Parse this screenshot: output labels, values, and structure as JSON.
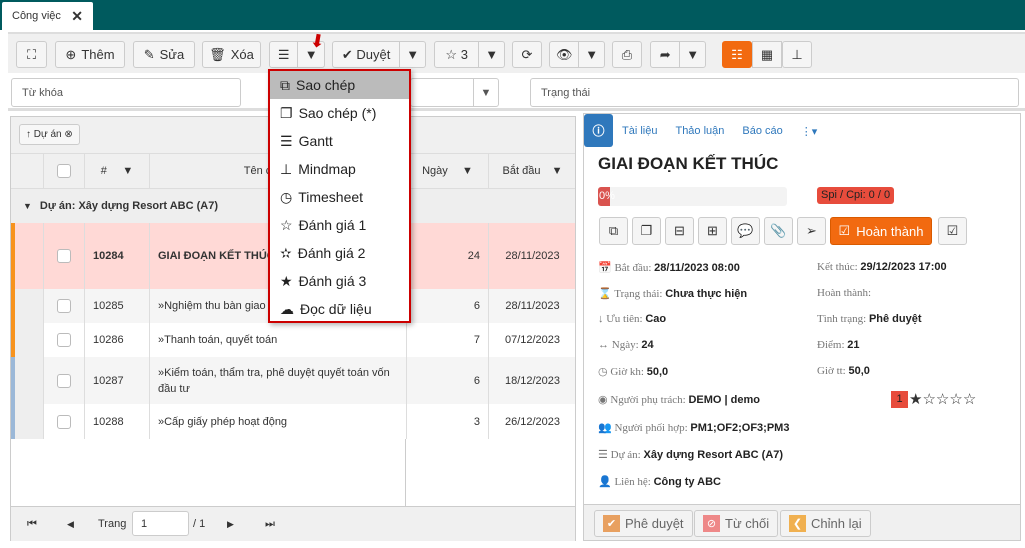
{
  "tab": {
    "label": "Công việc"
  },
  "toolbar": {
    "add": "Thêm",
    "edit": "Sửa",
    "delete": "Xóa",
    "approve": "Duyệt",
    "rating": "3"
  },
  "filters": {
    "keyword_placeholder": "Từ khóa",
    "status_placeholder": "Trạng thái"
  },
  "group_chip": "Dự án",
  "grid": {
    "columns": [
      "#",
      "Tên công việc",
      "Ngày",
      "Bắt đầu"
    ],
    "group": "Dự án: Xây dựng Resort ABC (A7)",
    "rows": [
      {
        "id": "10284",
        "name": "GIAI ĐOẠN KẾT THÚC",
        "days": "24",
        "start": "28/11/2023",
        "color": "#f7931e"
      },
      {
        "id": "10285",
        "name": "»Nghiệm thu bàn giao công trình",
        "days": "6",
        "start": "28/11/2023",
        "color": "#f7931e"
      },
      {
        "id": "10286",
        "name": "»Thanh toán, quyết toán",
        "days": "7",
        "start": "07/12/2023",
        "color": "#f7931e"
      },
      {
        "id": "10287",
        "name": "»Kiểm toán, thẩm tra, phê duyệt quyết toán vốn đầu tư",
        "days": "6",
        "start": "18/12/2023",
        "color": "#9bb8d8"
      },
      {
        "id": "10288",
        "name": "»Cấp giấy phép hoạt động",
        "days": "3",
        "start": "26/12/2023",
        "color": "#9bb8d8"
      }
    ]
  },
  "pager": {
    "label": "Trang",
    "page": "1",
    "total": "/ 1"
  },
  "menu": [
    "Sao chép",
    "Sao chép (*)",
    "Gantt",
    "Mindmap",
    "Timesheet",
    "Đánh giá 1",
    "Đánh giá 2",
    "Đánh giá 3",
    "Đọc dữ liệu"
  ],
  "detail": {
    "tabs": [
      "Tài liệu",
      "Thảo luận",
      "Báo cáo"
    ],
    "title": "GIAI ĐOẠN KẾT THÚC",
    "progress_percent": 0,
    "progress_label": "0%",
    "spi": "Spi / Cpi: 0 / 0",
    "complete_btn": "Hoàn thành",
    "props": {
      "start_l": "Bắt đầu:",
      "start": "28/11/2023 08:00",
      "end_l": "Kết thúc:",
      "end": "29/12/2023 17:00",
      "status_l": "Trạng thái:",
      "status": "Chưa thực hiện",
      "done_l": "Hoàn thành:",
      "prio_l": "Ưu tiên:",
      "prio": "Cao",
      "state_l": "Tình trạng:",
      "state": "Phê duyệt",
      "days_l": "Ngày:",
      "days": "24",
      "score_l": "Điểm:",
      "score": "21",
      "hplan_l": "Giờ kh:",
      "hplan": "50,0",
      "hact_l": "Giờ tt:",
      "hact": "50,0",
      "owner_l": "Người phụ trách:",
      "owner": "DEMO | demo",
      "coop_l": "Người phối hợp:",
      "coop": "PM1;OF2;OF3;PM3",
      "proj_l": "Dự án:",
      "proj": "Xây dựng Resort ABC (A7)",
      "contact_l": "Liên hệ:",
      "contact": "Công ty ABC"
    },
    "rating": "1",
    "stars_filled": 1,
    "stars_total": 5,
    "footer": {
      "approve": "Phê duyệt",
      "reject": "Từ chối",
      "revise": "Chỉnh lại"
    }
  },
  "colors": {
    "topbar": "#005a5e",
    "accent": "#f26a10",
    "menu_border": "#cc0000",
    "selected_row": "#ffd9d6"
  }
}
